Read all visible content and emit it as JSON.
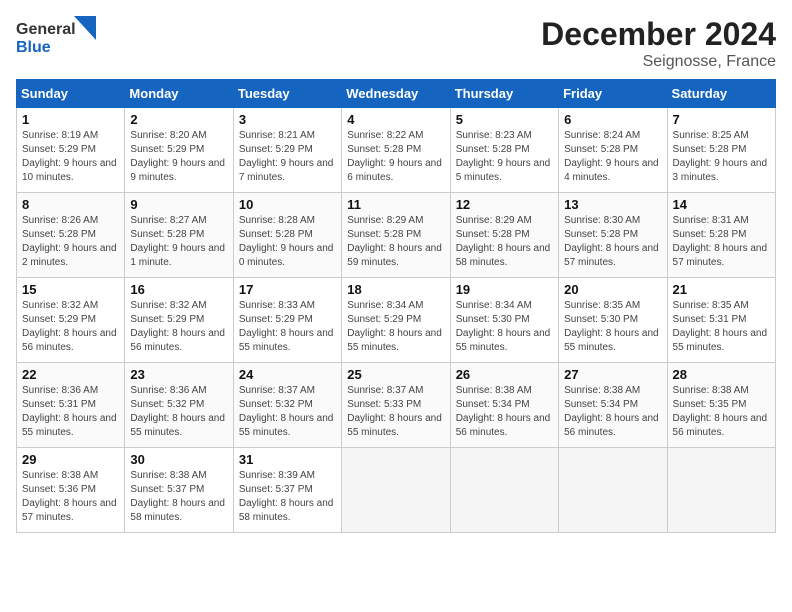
{
  "header": {
    "logo_line1": "General",
    "logo_line2": "Blue",
    "month_year": "December 2024",
    "location": "Seignosse, France"
  },
  "weekdays": [
    "Sunday",
    "Monday",
    "Tuesday",
    "Wednesday",
    "Thursday",
    "Friday",
    "Saturday"
  ],
  "weeks": [
    [
      {
        "day": "1",
        "sunrise": "8:19 AM",
        "sunset": "5:29 PM",
        "daylight": "9 hours and 10 minutes."
      },
      {
        "day": "2",
        "sunrise": "8:20 AM",
        "sunset": "5:29 PM",
        "daylight": "9 hours and 9 minutes."
      },
      {
        "day": "3",
        "sunrise": "8:21 AM",
        "sunset": "5:29 PM",
        "daylight": "9 hours and 7 minutes."
      },
      {
        "day": "4",
        "sunrise": "8:22 AM",
        "sunset": "5:28 PM",
        "daylight": "9 hours and 6 minutes."
      },
      {
        "day": "5",
        "sunrise": "8:23 AM",
        "sunset": "5:28 PM",
        "daylight": "9 hours and 5 minutes."
      },
      {
        "day": "6",
        "sunrise": "8:24 AM",
        "sunset": "5:28 PM",
        "daylight": "9 hours and 4 minutes."
      },
      {
        "day": "7",
        "sunrise": "8:25 AM",
        "sunset": "5:28 PM",
        "daylight": "9 hours and 3 minutes."
      }
    ],
    [
      {
        "day": "8",
        "sunrise": "8:26 AM",
        "sunset": "5:28 PM",
        "daylight": "9 hours and 2 minutes."
      },
      {
        "day": "9",
        "sunrise": "8:27 AM",
        "sunset": "5:28 PM",
        "daylight": "9 hours and 1 minute."
      },
      {
        "day": "10",
        "sunrise": "8:28 AM",
        "sunset": "5:28 PM",
        "daylight": "9 hours and 0 minutes."
      },
      {
        "day": "11",
        "sunrise": "8:29 AM",
        "sunset": "5:28 PM",
        "daylight": "8 hours and 59 minutes."
      },
      {
        "day": "12",
        "sunrise": "8:29 AM",
        "sunset": "5:28 PM",
        "daylight": "8 hours and 58 minutes."
      },
      {
        "day": "13",
        "sunrise": "8:30 AM",
        "sunset": "5:28 PM",
        "daylight": "8 hours and 57 minutes."
      },
      {
        "day": "14",
        "sunrise": "8:31 AM",
        "sunset": "5:28 PM",
        "daylight": "8 hours and 57 minutes."
      }
    ],
    [
      {
        "day": "15",
        "sunrise": "8:32 AM",
        "sunset": "5:29 PM",
        "daylight": "8 hours and 56 minutes."
      },
      {
        "day": "16",
        "sunrise": "8:32 AM",
        "sunset": "5:29 PM",
        "daylight": "8 hours and 56 minutes."
      },
      {
        "day": "17",
        "sunrise": "8:33 AM",
        "sunset": "5:29 PM",
        "daylight": "8 hours and 55 minutes."
      },
      {
        "day": "18",
        "sunrise": "8:34 AM",
        "sunset": "5:29 PM",
        "daylight": "8 hours and 55 minutes."
      },
      {
        "day": "19",
        "sunrise": "8:34 AM",
        "sunset": "5:30 PM",
        "daylight": "8 hours and 55 minutes."
      },
      {
        "day": "20",
        "sunrise": "8:35 AM",
        "sunset": "5:30 PM",
        "daylight": "8 hours and 55 minutes."
      },
      {
        "day": "21",
        "sunrise": "8:35 AM",
        "sunset": "5:31 PM",
        "daylight": "8 hours and 55 minutes."
      }
    ],
    [
      {
        "day": "22",
        "sunrise": "8:36 AM",
        "sunset": "5:31 PM",
        "daylight": "8 hours and 55 minutes."
      },
      {
        "day": "23",
        "sunrise": "8:36 AM",
        "sunset": "5:32 PM",
        "daylight": "8 hours and 55 minutes."
      },
      {
        "day": "24",
        "sunrise": "8:37 AM",
        "sunset": "5:32 PM",
        "daylight": "8 hours and 55 minutes."
      },
      {
        "day": "25",
        "sunrise": "8:37 AM",
        "sunset": "5:33 PM",
        "daylight": "8 hours and 55 minutes."
      },
      {
        "day": "26",
        "sunrise": "8:38 AM",
        "sunset": "5:34 PM",
        "daylight": "8 hours and 56 minutes."
      },
      {
        "day": "27",
        "sunrise": "8:38 AM",
        "sunset": "5:34 PM",
        "daylight": "8 hours and 56 minutes."
      },
      {
        "day": "28",
        "sunrise": "8:38 AM",
        "sunset": "5:35 PM",
        "daylight": "8 hours and 56 minutes."
      }
    ],
    [
      {
        "day": "29",
        "sunrise": "8:38 AM",
        "sunset": "5:36 PM",
        "daylight": "8 hours and 57 minutes."
      },
      {
        "day": "30",
        "sunrise": "8:38 AM",
        "sunset": "5:37 PM",
        "daylight": "8 hours and 58 minutes."
      },
      {
        "day": "31",
        "sunrise": "8:39 AM",
        "sunset": "5:37 PM",
        "daylight": "8 hours and 58 minutes."
      },
      null,
      null,
      null,
      null
    ]
  ]
}
